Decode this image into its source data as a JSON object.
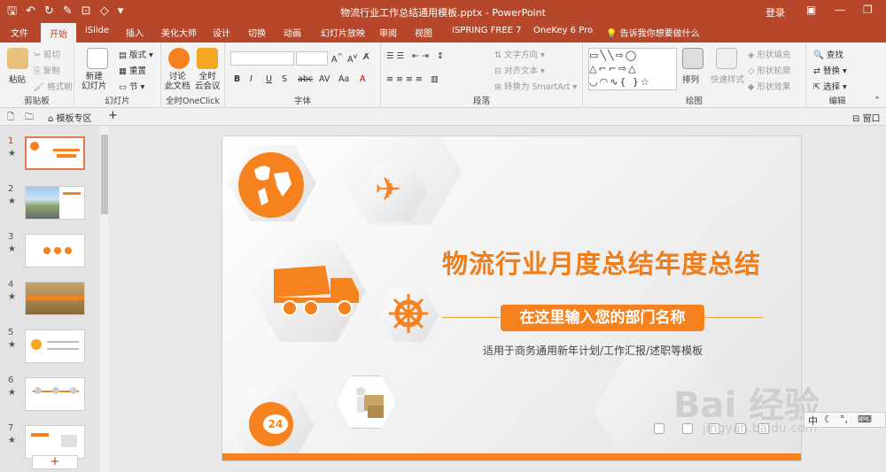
{
  "window": {
    "title": "物流行业工作总结通用模板.pptx  -  PowerPoint",
    "login": "登录",
    "quick_access": [
      "save-icon",
      "undo-icon",
      "redo-icon",
      "pen-icon",
      "format-painter-icon",
      "shape-icon",
      "customize-icon"
    ]
  },
  "tabs": [
    {
      "label": "文件"
    },
    {
      "label": "开始"
    },
    {
      "label": "iSlide"
    },
    {
      "label": "插入"
    },
    {
      "label": "美化大师"
    },
    {
      "label": "设计"
    },
    {
      "label": "切换"
    },
    {
      "label": "动画"
    },
    {
      "label": "幻灯片放映"
    },
    {
      "label": "审阅"
    },
    {
      "label": "视图"
    },
    {
      "label": "ISPRING FREE 7"
    },
    {
      "label": "OneKey 6 Pro"
    }
  ],
  "tell_me": "告诉我你想要做什么",
  "ribbon": {
    "clipboard": {
      "paste": "粘贴",
      "cut": "剪切",
      "copy": "复制",
      "format_painter": "格式刷",
      "label": "剪贴板"
    },
    "slides": {
      "new_slide": "新建\n幻灯片",
      "layout": "版式",
      "reset": "重置",
      "section": "节",
      "label": "幻灯片"
    },
    "oneclick": {
      "discuss": "讨论\n此文档",
      "meeting": "全时\n云会议",
      "label": "全时OneClick"
    },
    "font": {
      "label": "字体",
      "buttons": [
        "B",
        "I",
        "U",
        "S",
        "abc",
        "AV",
        "Aa",
        "A"
      ]
    },
    "paragraph": {
      "label": "段落",
      "text_direction": "文字方向",
      "align_text": "对齐文本",
      "smartart": "转换为 SmartArt"
    },
    "drawing": {
      "label": "绘图",
      "arrange": "排列",
      "quick_styles": "快速样式",
      "fill": "形状填充",
      "outline": "形状轮廓",
      "effects": "形状效果"
    },
    "editing": {
      "label": "编辑",
      "find": "查找",
      "replace": "替换",
      "select": "选择"
    }
  },
  "toolstrip": {
    "template_zone": "模板专区",
    "add_tab": "+",
    "window_label": "窗口"
  },
  "thumbnails": [
    {
      "num": "1",
      "active": true
    },
    {
      "num": "2",
      "active": false
    },
    {
      "num": "3",
      "active": false
    },
    {
      "num": "4",
      "active": false
    },
    {
      "num": "5",
      "active": false
    },
    {
      "num": "6",
      "active": false
    },
    {
      "num": "7",
      "active": false
    }
  ],
  "thumb_star": "★",
  "add_slide": "+",
  "slide": {
    "title": "物流行业月度总结年度总结",
    "subtitle": "在这里输入您的部门名称",
    "description": "适用于商务通用新年计划/工作汇报/述职等模板",
    "badge_24": "24",
    "accent": "#f5821f",
    "title_color": "#ee7d1a"
  },
  "watermark": {
    "brand": "Bai 经验",
    "url": "jingyan.baidu.com"
  },
  "ime_tray": {
    "lang": "中"
  },
  "colors": {
    "brand": "#b7472a",
    "ribbon_bg": "#f3f3f3"
  }
}
